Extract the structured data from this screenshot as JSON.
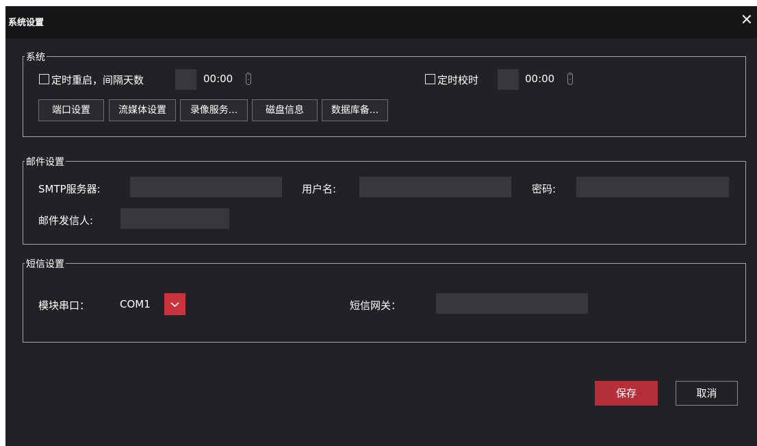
{
  "window": {
    "title": "系统设置",
    "close_icon": "close-icon"
  },
  "system": {
    "legend": "系统",
    "reboot": {
      "label": "定时重启，间隔天数",
      "days_value": "",
      "time_value": "00:00"
    },
    "timesync": {
      "label": "定时校时",
      "value": "",
      "time_value": "00:00"
    },
    "buttons": [
      "端口设置",
      "流媒体设置",
      "录像服务...",
      "磁盘信息",
      "数据库备..."
    ]
  },
  "mail": {
    "legend": "邮件设置",
    "smtp_label": "SMTP服务器:",
    "smtp_value": "",
    "user_label": "用户名:",
    "user_value": "",
    "password_label": "密码:",
    "password_value": "",
    "sender_label": "邮件发信人:",
    "sender_value": ""
  },
  "sms": {
    "legend": "短信设置",
    "port_label": "模块串口：",
    "port_value": "COM1",
    "gateway_label": "短信网关：",
    "gateway_value": ""
  },
  "footer": {
    "save_label": "保存",
    "cancel_label": "取消"
  },
  "colors": {
    "accent": "#b42f37",
    "background": "#222226",
    "field": "#37373c",
    "titlebar": "#161618"
  }
}
